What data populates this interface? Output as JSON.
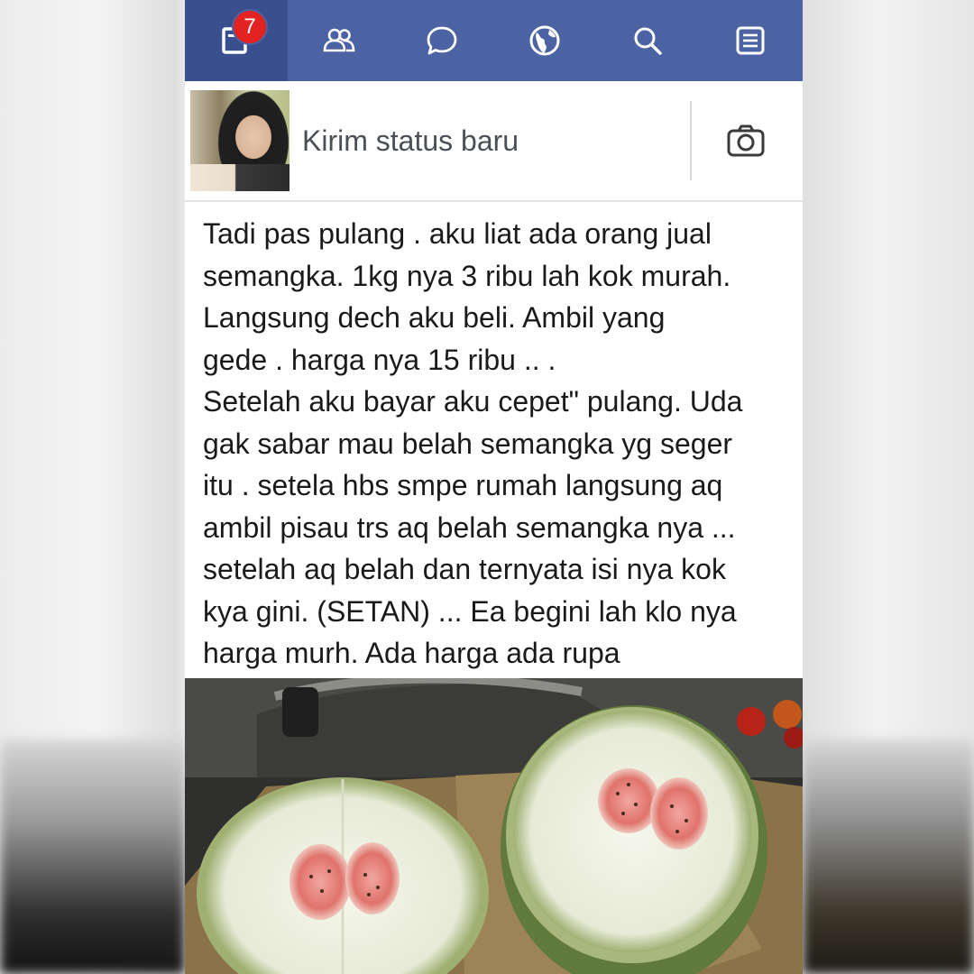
{
  "nav": {
    "items": [
      {
        "name": "news-feed",
        "icon": "feed-icon",
        "active": true
      },
      {
        "name": "friends",
        "icon": "friends-icon",
        "active": false
      },
      {
        "name": "messages",
        "icon": "chat-icon",
        "active": false
      },
      {
        "name": "notifications",
        "icon": "globe-icon",
        "active": false
      },
      {
        "name": "search",
        "icon": "search-icon",
        "active": false
      },
      {
        "name": "more",
        "icon": "menu-list-icon",
        "active": false
      }
    ],
    "badge_count": "7",
    "bar_color": "#4b63a3",
    "badge_color": "#e32222"
  },
  "composer": {
    "placeholder": "Kirim status baru",
    "camera_icon": "camera-icon"
  },
  "post": {
    "lines": [
      "Tadi pas pulang . aku liat ada orang jual",
      "semangka. 1kg nya 3 ribu lah kok murah.",
      "Langsung dech aku beli. Ambil yang",
      "gede . harga nya 15 ribu .. .",
      "Setelah aku bayar aku cepet\" pulang. Uda",
      "gak sabar mau belah semangka yg seger",
      "itu . setela hbs smpe rumah langsung aq",
      "ambil pisau trs aq belah semangka nya ...",
      "setelah aq belah dan ternyata isi nya kok",
      "kya gini. (SETAN) ... Ea begini lah klo nya",
      "harga murh. Ada harga ada rupa"
    ]
  }
}
